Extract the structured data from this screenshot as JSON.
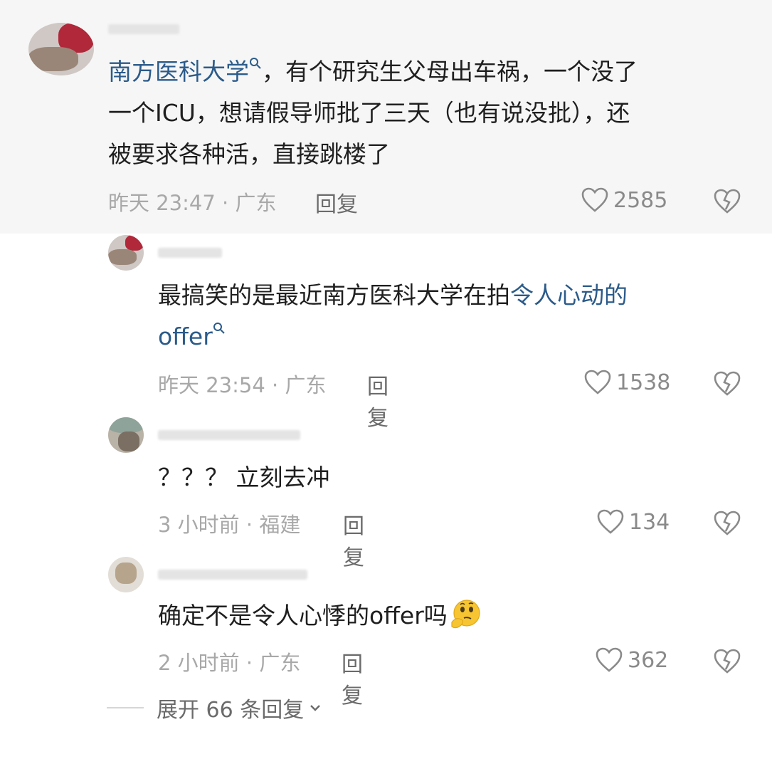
{
  "main_comment": {
    "link_text": "南方医科大学",
    "text_line1_rest": "，有个研究生父母出车祸，一个没了",
    "text_line2": "一个ICU，想请假导师批了三天（也有说没批），还",
    "text_line3": "被要求各种活，直接跳楼了",
    "meta": "昨天 23:47 · 广东",
    "reply_label": "回复",
    "likes": "2585"
  },
  "replies": [
    {
      "text_plain": "最搞笑的是最近南方医科大学在拍",
      "text_link1": "令人心动的",
      "text_link2": "offer",
      "meta": "昨天 23:54 · 广东",
      "reply_label": "回复",
      "likes": "1538"
    },
    {
      "text": "？？？ 立刻去冲",
      "meta": "3 小时前 · 福建",
      "reply_label": "回复",
      "likes": "134"
    },
    {
      "text": "确定不是令人心悸的offer吗",
      "meta": "2 小时前 · 广东",
      "reply_label": "回复",
      "likes": "362"
    }
  ],
  "expand": {
    "label": "展开 66 条回复"
  },
  "icons": {
    "search": "search-icon",
    "heart": "heart-icon",
    "broken_heart": "broken-heart-icon",
    "chevron": "chevron-down-icon",
    "emoji": "thinking-emoji-icon"
  },
  "colors": {
    "link": "#2b5b8a",
    "meta": "#a8a8a8",
    "highlight_bg": "#f6f6f6"
  }
}
